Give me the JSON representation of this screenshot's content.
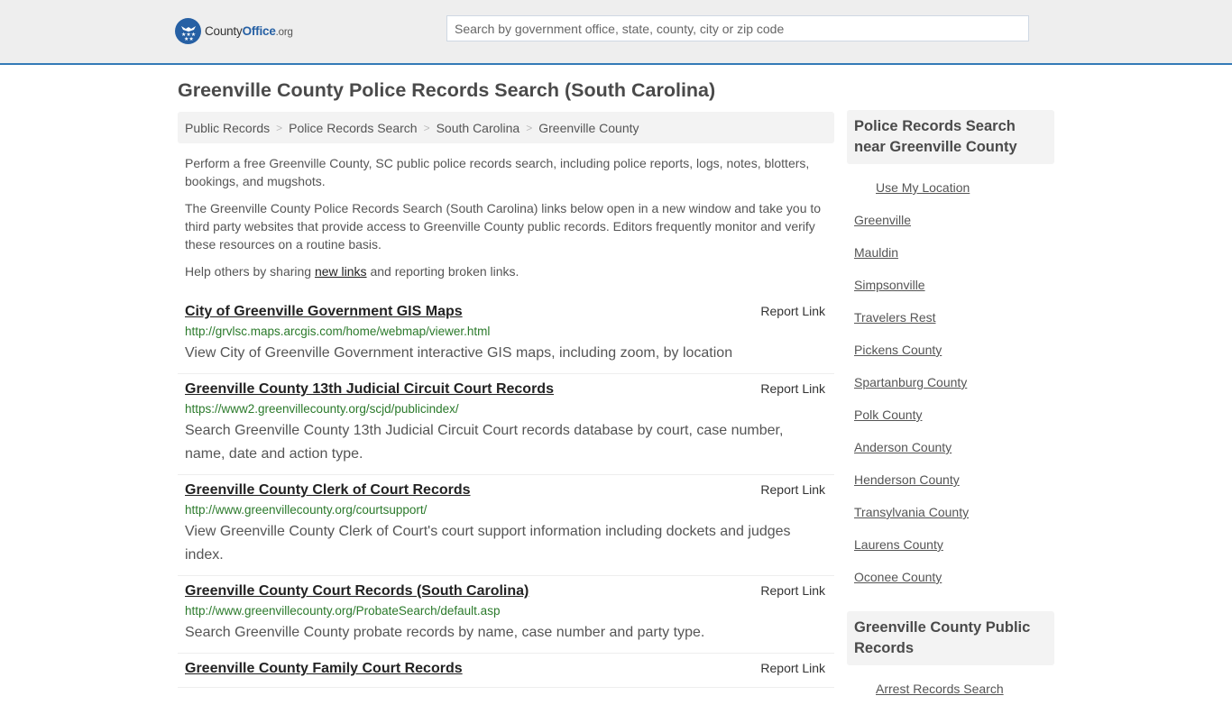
{
  "header": {
    "logo": {
      "part1": "County",
      "part2": "Office",
      "part3": ".org"
    },
    "search_placeholder": "Search by government office, state, county, city or zip code"
  },
  "page_title": "Greenville County Police Records Search (South Carolina)",
  "breadcrumb": [
    {
      "label": "Public Records"
    },
    {
      "label": "Police Records Search"
    },
    {
      "label": "South Carolina"
    },
    {
      "label": "Greenville County"
    }
  ],
  "breadcrumb_separator": ">",
  "intro": {
    "p1": "Perform a free Greenville County, SC public police records search, including police reports, logs, notes, blotters, bookings, and mugshots.",
    "p2": "The Greenville County Police Records Search (South Carolina) links below open in a new window and take you to third party websites that provide access to Greenville County public records. Editors frequently monitor and verify these resources on a routine basis.",
    "p3_before": "Help others by sharing ",
    "p3_link": "new links",
    "p3_after": " and reporting broken links."
  },
  "report_label": "Report Link",
  "results": [
    {
      "title": "City of Greenville Government GIS Maps",
      "url": "http://grvlsc.maps.arcgis.com/home/webmap/viewer.html",
      "desc": "View City of Greenville Government interactive GIS maps, including zoom, by location"
    },
    {
      "title": "Greenville County 13th Judicial Circuit Court Records",
      "url": "https://www2.greenvillecounty.org/scjd/publicindex/",
      "desc": "Search Greenville County 13th Judicial Circuit Court records database by court, case number, name, date and action type."
    },
    {
      "title": "Greenville County Clerk of Court Records",
      "url": "http://www.greenvillecounty.org/courtsupport/",
      "desc": "View Greenville County Clerk of Court's court support information including dockets and judges index."
    },
    {
      "title": "Greenville County Court Records (South Carolina)",
      "url": "http://www.greenvillecounty.org/ProbateSearch/default.asp",
      "desc": "Search Greenville County probate records by name, case number and party type."
    },
    {
      "title": "Greenville County Family Court Records",
      "url": "",
      "desc": ""
    }
  ],
  "sidebar": {
    "near_heading": "Police Records Search near Greenville County",
    "use_location": "Use My Location",
    "near_links": [
      "Greenville",
      "Mauldin",
      "Simpsonville",
      "Travelers Rest",
      "Pickens County",
      "Spartanburg County",
      "Polk County",
      "Anderson County",
      "Henderson County",
      "Transylvania County",
      "Laurens County",
      "Oconee County"
    ],
    "public_heading": "Greenville County Public Records",
    "public_links": [
      "Arrest Records Search"
    ]
  }
}
